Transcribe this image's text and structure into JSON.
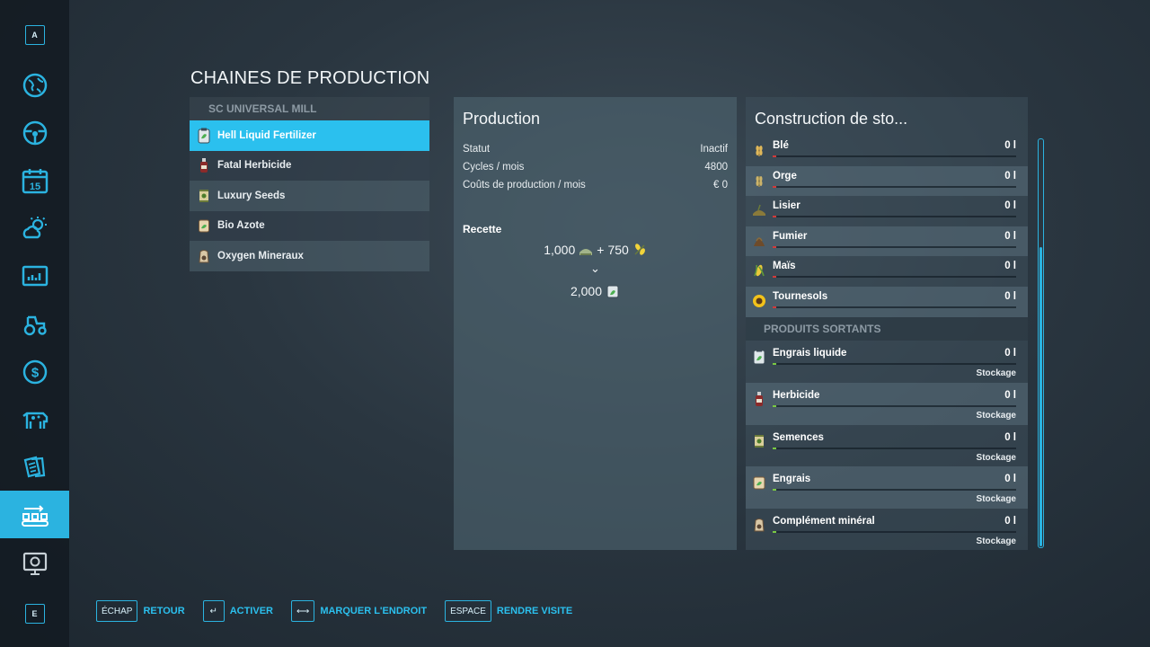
{
  "sidebar": {
    "top_key": "A",
    "bottom_key": "E",
    "items": [
      {
        "icon": "map-globe-icon"
      },
      {
        "icon": "steering-wheel-icon"
      },
      {
        "icon": "calendar-icon",
        "label": "15"
      },
      {
        "icon": "weather-icon"
      },
      {
        "icon": "prices-chart-icon"
      },
      {
        "icon": "tractor-icon"
      },
      {
        "icon": "finances-dollar-icon"
      },
      {
        "icon": "animals-cow-icon"
      },
      {
        "icon": "contracts-icon"
      },
      {
        "icon": "production-chains-icon",
        "active": true
      },
      {
        "icon": "help-screen-icon"
      }
    ]
  },
  "page_title": "CHAINES DE PRODUCTION",
  "chains": {
    "group": "SC UNIVERSAL MILL",
    "items": [
      {
        "label": "Hell Liquid Fertilizer",
        "icon": "liquid-fertilizer-icon",
        "selected": true
      },
      {
        "label": "Fatal Herbicide",
        "icon": "herbicide-bottle-icon"
      },
      {
        "label": "Luxury Seeds",
        "icon": "seed-bag-icon"
      },
      {
        "label": "Bio Azote",
        "icon": "fertilizer-bag-icon"
      },
      {
        "label": "Oxygen Mineraux",
        "icon": "mineral-sack-icon"
      }
    ]
  },
  "production": {
    "title": "Production",
    "stats": [
      {
        "label": "Statut",
        "value": "Inactif"
      },
      {
        "label": "Cycles / mois",
        "value": "4800"
      },
      {
        "label": "Coûts de production / mois",
        "value": "€ 0"
      }
    ],
    "recipe_label": "Recette",
    "recipe_input_1": "1,000",
    "recipe_plus": "+",
    "recipe_input_2": "750",
    "recipe_arrow": "⌄",
    "recipe_output": "2,000"
  },
  "storage": {
    "title": "Construction de sto...",
    "inputs": [
      {
        "name": "Blé",
        "qty": "0 l",
        "icon": "wheat-icon",
        "fill": 0
      },
      {
        "name": "Orge",
        "qty": "0 l",
        "icon": "barley-icon",
        "fill": 0
      },
      {
        "name": "Lisier",
        "qty": "0 l",
        "icon": "slurry-icon",
        "fill": 0
      },
      {
        "name": "Fumier",
        "qty": "0 l",
        "icon": "manure-icon",
        "fill": 0
      },
      {
        "name": "Maïs",
        "qty": "0 l",
        "icon": "maize-icon",
        "fill": 0
      },
      {
        "name": "Tournesols",
        "qty": "0 l",
        "icon": "sunflower-icon",
        "fill": 0
      }
    ],
    "outputs_header": "PRODUITS SORTANTS",
    "outputs": [
      {
        "name": "Engrais liquide",
        "qty": "0 l",
        "mode": "Stockage",
        "icon": "liquid-fertilizer-icon",
        "fill": 0
      },
      {
        "name": "Herbicide",
        "qty": "0 l",
        "mode": "Stockage",
        "icon": "herbicide-bottle-icon",
        "fill": 0
      },
      {
        "name": "Semences",
        "qty": "0 l",
        "mode": "Stockage",
        "icon": "seed-bag-icon",
        "fill": 0
      },
      {
        "name": "Engrais",
        "qty": "0 l",
        "mode": "Stockage",
        "icon": "fertilizer-bag-icon",
        "fill": 0
      },
      {
        "name": "Complément minéral",
        "qty": "0 l",
        "mode": "Stockage",
        "icon": "mineral-sack-icon",
        "fill": 0
      }
    ]
  },
  "footer": [
    {
      "key": "ÉCHAP",
      "label": "RETOUR"
    },
    {
      "key": "↵",
      "label": "ACTIVER"
    },
    {
      "key": "⟷",
      "label": "MARQUER L'ENDROIT"
    },
    {
      "key": "ESPACE",
      "label": "RENDRE VISITE"
    }
  ],
  "colors": {
    "accent": "#2bb3e0",
    "selected": "#2bc0ee",
    "input_bar": "#d23a3a",
    "output_bar": "#7ac943"
  }
}
